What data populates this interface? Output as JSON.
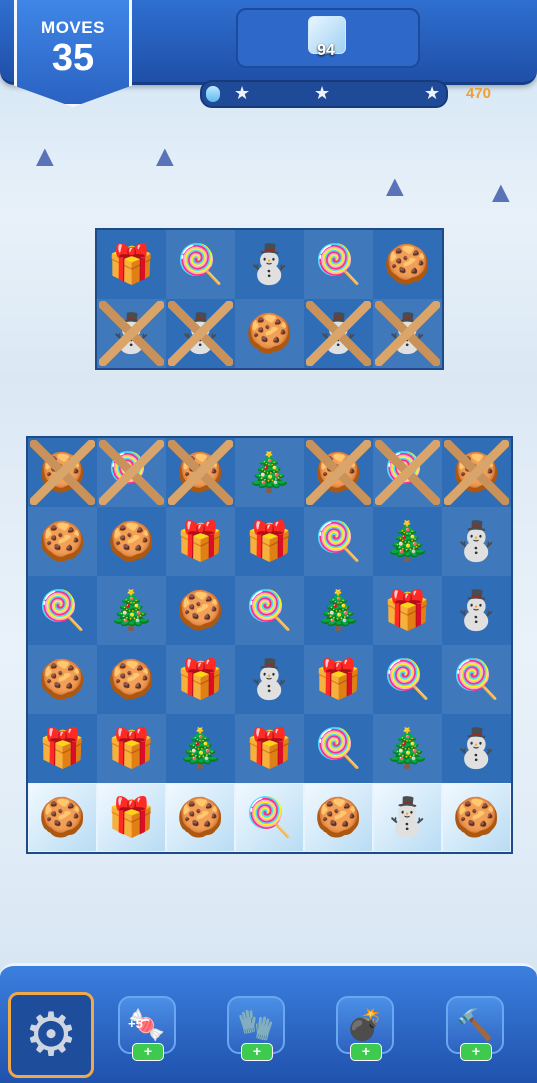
{
  "hud": {
    "moves_label": "MOVES",
    "moves_value": "35",
    "goal_count": "94",
    "score": "470",
    "progress_fraction": 0.06
  },
  "colors": {
    "accent": "#2f6fd0",
    "score": "#f0a030",
    "plus": "#3ec94f"
  },
  "icons": {
    "gift": "🎁",
    "candy": "🍭",
    "snowman": "⛄",
    "gingerbread": "🍪",
    "tree": "🎄"
  },
  "board_top": [
    [
      "gift",
      "candy",
      "snowman",
      "candy",
      "gingerbread"
    ],
    [
      "snowman",
      "snowman",
      "gingerbread",
      "snowman",
      "snowman"
    ]
  ],
  "board_top_ropes": [
    [
      0,
      0,
      0,
      0,
      0
    ],
    [
      1,
      1,
      0,
      1,
      1
    ]
  ],
  "board_main": [
    [
      "gingerbread",
      "candy",
      "gingerbread",
      "tree",
      "gingerbread",
      "candy",
      "gingerbread"
    ],
    [
      "gingerbread",
      "gingerbread",
      "gift",
      "gift",
      "candy",
      "tree",
      "snowman"
    ],
    [
      "candy",
      "tree",
      "gingerbread",
      "candy",
      "tree",
      "gift",
      "snowman"
    ],
    [
      "gingerbread",
      "gingerbread",
      "gift",
      "snowman",
      "gift",
      "candy",
      "candy"
    ],
    [
      "gift",
      "gift",
      "tree",
      "gift",
      "candy",
      "tree",
      "snowman"
    ],
    [
      "gingerbread",
      "gift",
      "gingerbread",
      "candy",
      "gingerbread",
      "snowman",
      "gingerbread"
    ]
  ],
  "board_main_ropes": [
    [
      1,
      1,
      1,
      0,
      1,
      1,
      1
    ],
    [
      0,
      0,
      0,
      0,
      0,
      0,
      0
    ],
    [
      0,
      0,
      0,
      0,
      0,
      0,
      0
    ],
    [
      0,
      0,
      0,
      0,
      0,
      0,
      0
    ],
    [
      0,
      0,
      0,
      0,
      0,
      0,
      0
    ],
    [
      0,
      0,
      0,
      0,
      0,
      0,
      0
    ]
  ],
  "board_main_frozen": [
    0,
    0,
    0,
    0,
    0,
    1
  ],
  "boosters": [
    {
      "name": "lollipop-booster",
      "icon": "🍬",
      "plus": "+",
      "badge": "+5"
    },
    {
      "name": "glove-booster",
      "icon": "🧤",
      "plus": "+"
    },
    {
      "name": "bomb-booster",
      "icon": "💣",
      "plus": "+"
    },
    {
      "name": "hammer-booster",
      "icon": "🔨",
      "plus": "+"
    }
  ]
}
